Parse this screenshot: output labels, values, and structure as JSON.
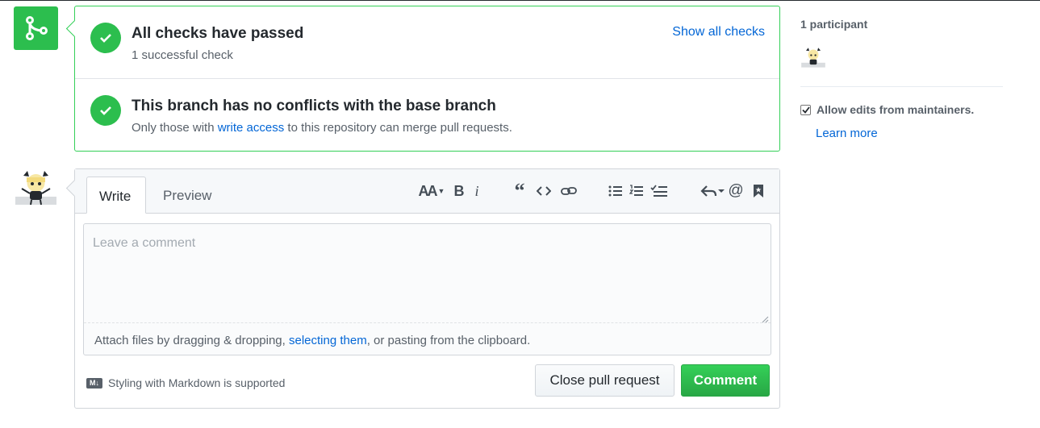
{
  "merge_status": {
    "checks": {
      "title": "All checks have passed",
      "subtitle": "1 successful check",
      "link": "Show all checks"
    },
    "conflicts": {
      "title": "This branch has no conflicts with the base branch",
      "subtitle_pre": "Only those with ",
      "subtitle_link": "write access",
      "subtitle_post": " to this repository can merge pull requests."
    }
  },
  "editor": {
    "tabs": [
      "Write",
      "Preview"
    ],
    "active_tab": "Write",
    "toolbar": [
      "header-icon",
      "bold-icon",
      "italic-icon",
      "quote-icon",
      "code-icon",
      "link-icon",
      "bullet-list-icon",
      "numbered-list-icon",
      "task-list-icon",
      "reply-icon",
      "mention-icon",
      "bookmark-icon"
    ],
    "placeholder": "Leave a comment",
    "attach_pre": "Attach files by dragging & dropping, ",
    "attach_link": "selecting them",
    "attach_post": ", or pasting from the clipboard.",
    "markdown_note": "Styling with Markdown is supported",
    "close_button": "Close pull request",
    "comment_button": "Comment"
  },
  "sidebar": {
    "participants_label": "1 participant",
    "allow_edits_label": "Allow edits from maintainers.",
    "allow_edits_checked": true,
    "learn_more": "Learn more"
  },
  "colors": {
    "success": "#2cbe4e",
    "link": "#0366d6",
    "border": "#d1d5da"
  }
}
